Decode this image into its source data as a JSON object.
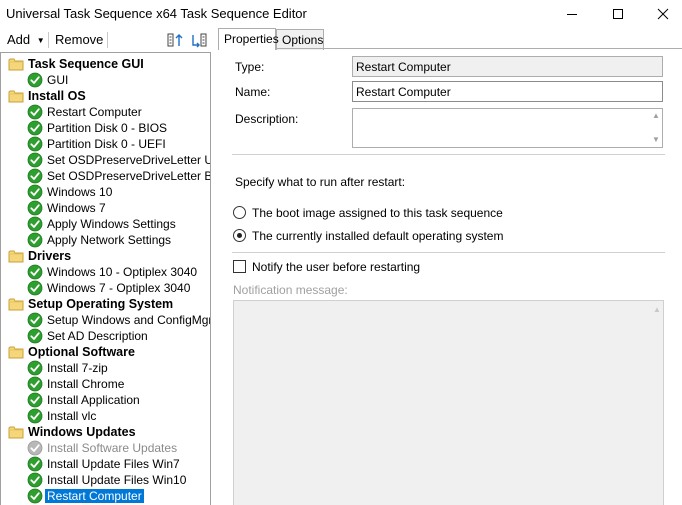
{
  "window": {
    "title": "Universal Task Sequence x64 Task Sequence Editor",
    "controls": [
      "minimize-icon",
      "maximize-icon",
      "close-icon"
    ]
  },
  "toolbar": {
    "add_label": "Add",
    "remove_label": "Remove",
    "icons": [
      "move-up-icon",
      "move-down-icon"
    ]
  },
  "tree": {
    "items": [
      {
        "label": "Task Sequence GUI",
        "type": "group",
        "icon": "folder-icon"
      },
      {
        "label": "GUI",
        "type": "step",
        "icon": "check-icon"
      },
      {
        "label": "Install OS",
        "type": "group",
        "icon": "folder-icon"
      },
      {
        "label": "Restart Computer",
        "type": "step",
        "icon": "check-icon"
      },
      {
        "label": "Partition Disk 0 - BIOS",
        "type": "step",
        "icon": "check-icon"
      },
      {
        "label": "Partition Disk 0 - UEFI",
        "type": "step",
        "icon": "check-icon"
      },
      {
        "label": "Set OSDPreserveDriveLetter UEF",
        "type": "step",
        "icon": "check-icon"
      },
      {
        "label": "Set OSDPreserveDriveLetter BIOS",
        "type": "step",
        "icon": "check-icon"
      },
      {
        "label": "Windows 10",
        "type": "step",
        "icon": "check-icon"
      },
      {
        "label": "Windows 7",
        "type": "step",
        "icon": "check-icon"
      },
      {
        "label": "Apply Windows Settings",
        "type": "step",
        "icon": "check-icon"
      },
      {
        "label": "Apply Network Settings",
        "type": "step",
        "icon": "check-icon"
      },
      {
        "label": "Drivers",
        "type": "group",
        "icon": "folder-icon"
      },
      {
        "label": "Windows 10 - Optiplex 3040",
        "type": "step",
        "icon": "check-icon"
      },
      {
        "label": "Windows 7 - Optiplex 3040",
        "type": "step",
        "icon": "check-icon"
      },
      {
        "label": "Setup Operating System",
        "type": "group",
        "icon": "folder-icon"
      },
      {
        "label": "Setup Windows and ConfigMgr",
        "type": "step",
        "icon": "check-icon"
      },
      {
        "label": "Set AD Description",
        "type": "step",
        "icon": "check-icon"
      },
      {
        "label": "Optional Software",
        "type": "group",
        "icon": "folder-icon"
      },
      {
        "label": "Install 7-zip",
        "type": "step",
        "icon": "check-icon"
      },
      {
        "label": "Install Chrome",
        "type": "step",
        "icon": "check-icon"
      },
      {
        "label": "Install Application",
        "type": "step",
        "icon": "check-icon"
      },
      {
        "label": "Install vlc",
        "type": "step",
        "icon": "check-icon"
      },
      {
        "label": "Windows Updates",
        "type": "group",
        "icon": "folder-icon"
      },
      {
        "label": "Install Software Updates",
        "type": "step",
        "icon": "check-icon",
        "disabled": true
      },
      {
        "label": "Install Update Files Win7",
        "type": "step",
        "icon": "check-icon"
      },
      {
        "label": "Install Update Files Win10",
        "type": "step",
        "icon": "check-icon"
      },
      {
        "label": "Restart Computer",
        "type": "step",
        "icon": "check-icon",
        "selected": true
      }
    ]
  },
  "tabs": [
    {
      "label": "Properties",
      "active": true
    },
    {
      "label": "Options",
      "active": false
    }
  ],
  "properties": {
    "type_label": "Type:",
    "type_value": "Restart Computer",
    "name_label": "Name:",
    "name_value": "Restart Computer",
    "description_label": "Description:",
    "description_value": "",
    "restart_prompt": "Specify what to run after restart:",
    "option_boot_image": "The boot image assigned to this task sequence",
    "option_installed_os": "The currently installed default operating system",
    "selected_option": "installed_os",
    "notify_label": "Notify the user before restarting",
    "notify_checked": false,
    "notification_label": "Notification message:",
    "notification_value": ""
  },
  "colors": {
    "selection": "#0078d7",
    "check_green": "#2e9e2e",
    "folder_yellow": "#e8c45a"
  }
}
